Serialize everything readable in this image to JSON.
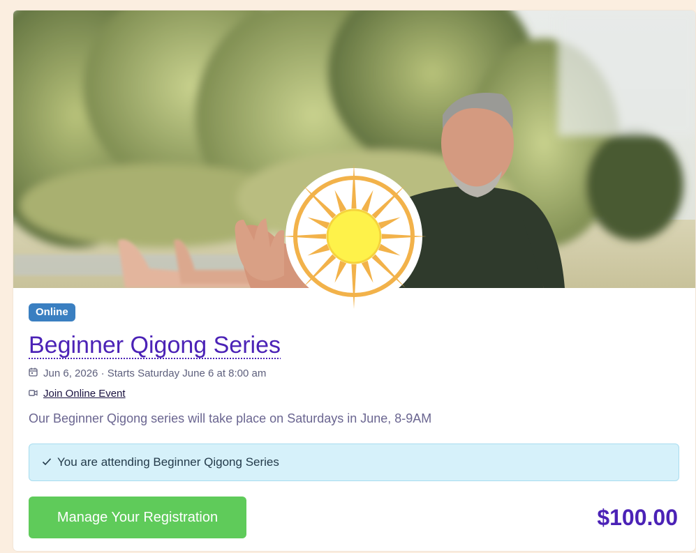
{
  "event": {
    "badge": "Online",
    "title": "Beginner Qigong Series",
    "date_line": "Jun 6, 2026 · Starts Saturday June 6 at 8:00 am",
    "online_link": "Join Online Event",
    "description": "Our Beginner Qigong series will take place on Saturdays in June, 8-9AM",
    "attending_notice": "You are attending Beginner Qigong Series",
    "manage_button": "Manage Your Registration",
    "price": "$100.00"
  },
  "icons": {
    "calendar": "calendar-icon",
    "video": "video-camera-icon",
    "check": "check-icon",
    "logo": "sun-logo"
  },
  "colors": {
    "background": "#fbeee0",
    "badge": "#3a7fc1",
    "title": "#4b22b6",
    "button": "#5fcb5a",
    "alert_bg": "#d6f1fa",
    "price": "#4b22b6"
  }
}
